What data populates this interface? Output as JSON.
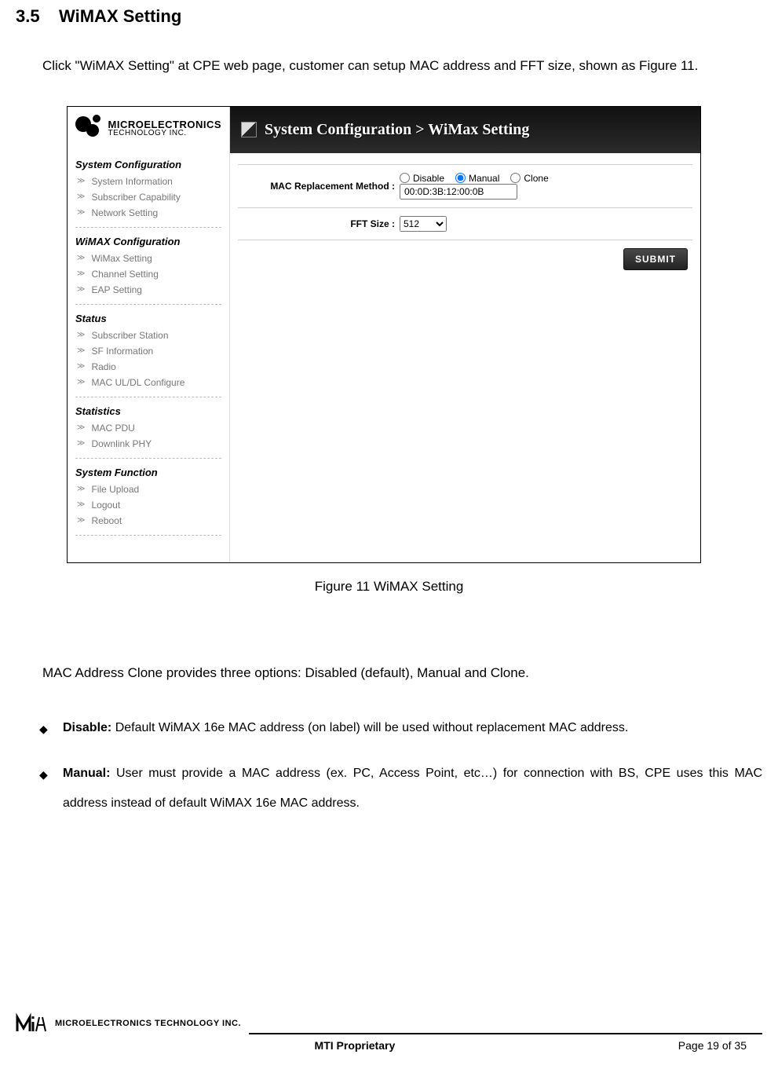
{
  "section": {
    "number": "3.5",
    "title": "WiMAX Setting"
  },
  "intro": "Click \"WiMAX Setting\" at CPE web page, customer can setup MAC address and FFT size, shown as Figure 11.",
  "figure_caption": "Figure 11    WiMAX Setting",
  "app": {
    "logo": {
      "line1": "MICROELECTRONICS",
      "line2": "TECHNOLOGY INC."
    },
    "header": "System Configuration > WiMax Setting",
    "sidebar": [
      {
        "title": "System Configuration",
        "items": [
          "System Information",
          "Subscriber Capability",
          "Network Setting"
        ]
      },
      {
        "title": "WiMAX Configuration",
        "items": [
          "WiMax Setting",
          "Channel Setting",
          "EAP Setting"
        ]
      },
      {
        "title": "Status",
        "items": [
          "Subscriber Station",
          "SF Information",
          "Radio",
          "MAC UL/DL Configure"
        ]
      },
      {
        "title": "Statistics",
        "items": [
          "MAC PDU",
          "Downlink PHY"
        ]
      },
      {
        "title": "System Function",
        "items": [
          "File Upload",
          "Logout",
          "Reboot"
        ]
      }
    ],
    "form": {
      "mac_label": "MAC Replacement Method :",
      "options": {
        "disable": "Disable",
        "manual": "Manual",
        "clone": "Clone"
      },
      "mac_value": "00:0D:3B:12:00:0B",
      "fft_label": "FFT Size :",
      "fft_value": "512",
      "submit": "SUBMIT"
    }
  },
  "explain_intro": "MAC Address Clone provides three options: Disabled (default), Manual and Clone.",
  "bullets": [
    {
      "label": "Disable:",
      "text": " Default WiMAX 16e MAC address (on label) will be used without replacement MAC address."
    },
    {
      "label": "Manual:",
      "text": " User must provide a MAC address (ex. PC, Access Point, etc…) for connection with BS, CPE uses this MAC address instead of default WiMAX 16e MAC address."
    }
  ],
  "footer": {
    "company": "MICROELECTRONICS TECHNOLOGY INC.",
    "proprietary": "MTI Proprietary",
    "page": "Page 19 of 35"
  }
}
